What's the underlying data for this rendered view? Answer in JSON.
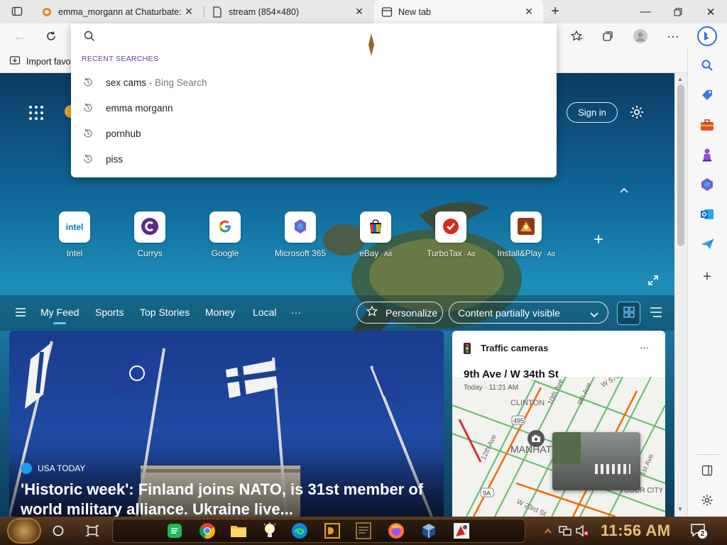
{
  "browser": {
    "tabs": [
      {
        "title": "emma_morgann at Chaturbate: l",
        "icon": "chaturbate-icon",
        "active": false
      },
      {
        "title": "stream (854×480)",
        "icon": "document-icon",
        "active": false
      },
      {
        "title": "New tab",
        "icon": "newtab-icon",
        "active": true
      }
    ],
    "favorites_bar": {
      "import_label": "Import favo"
    }
  },
  "omnibox": {
    "query": "",
    "recent_label": "RECENT SEARCHES",
    "suggestions": [
      {
        "text": "sex cams",
        "sub": " - Bing Search"
      },
      {
        "text": "emma morgann",
        "sub": ""
      },
      {
        "text": "pornhub",
        "sub": ""
      },
      {
        "text": "piss",
        "sub": ""
      }
    ]
  },
  "newtab": {
    "sign_in": "Sign in",
    "quick_links": [
      {
        "label": "Intel",
        "ad": "",
        "icon": "intel-icon"
      },
      {
        "label": "Currys",
        "ad": "",
        "icon": "currys-icon"
      },
      {
        "label": "Google",
        "ad": "",
        "icon": "google-icon"
      },
      {
        "label": "Microsoft 365",
        "ad": "",
        "icon": "m365-icon"
      },
      {
        "label": "eBay",
        "ad": " · Ad",
        "icon": "ebay-icon"
      },
      {
        "label": "TurboTax",
        "ad": " · Ad",
        "icon": "turbotax-icon"
      },
      {
        "label": "Install&Play",
        "ad": " · Ad",
        "icon": "installplay-icon"
      }
    ],
    "intel_logo_text": "intel",
    "feed_tabs": [
      "My Feed",
      "Sports",
      "Top Stories",
      "Money",
      "Local",
      "···"
    ],
    "personalize": "Personalize",
    "content_visibility": "Content partially visible",
    "hero": {
      "source": "USA TODAY",
      "headline": "'Historic week': Finland joins NATO, is 31st member of world military alliance. Ukraine live..."
    },
    "traffic": {
      "title": "Traffic cameras",
      "location": "9th Ave / W 34th St",
      "time": "Today · 11:21 AM",
      "map_labels": [
        "CLINTON",
        "MANHATTAN",
        "TUDOR CITY",
        "495",
        "9A",
        "12th Ave",
        "10th Ave",
        "9th Ave",
        "W 57th St",
        "W 23rd St",
        "1st Ave"
      ]
    }
  },
  "taskbar": {
    "clock": "11:56 AM",
    "notification_count": "2"
  },
  "colors": {
    "accent": "#0f6cbd",
    "bing_blue": "#2f6fdf",
    "taskbar": "#3a2414"
  }
}
